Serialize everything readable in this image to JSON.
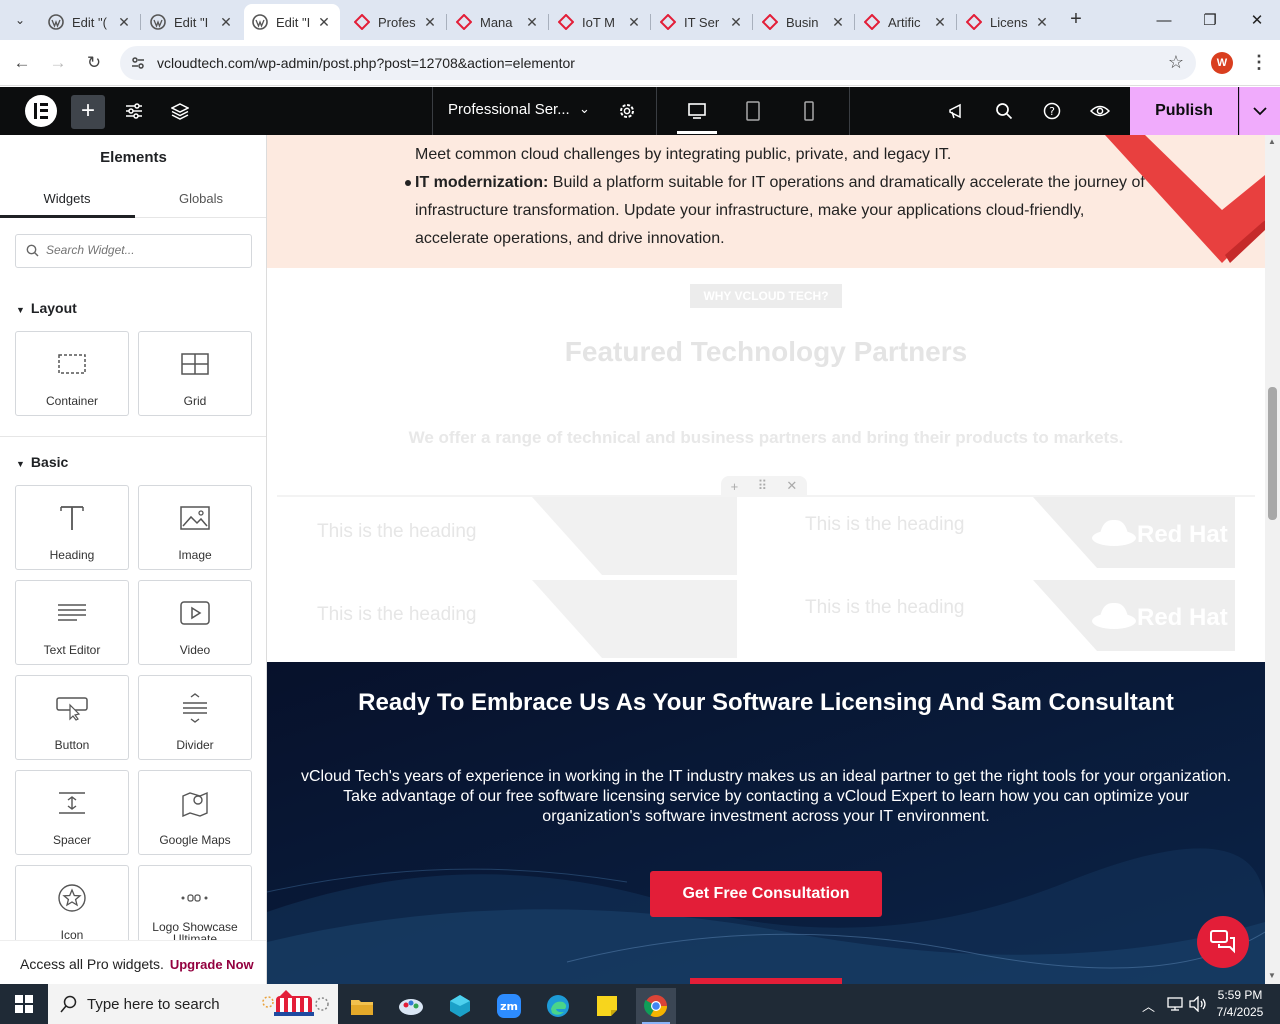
{
  "browser": {
    "tabs": [
      {
        "title": "Edit \"(",
        "icon": "wordpress-icon"
      },
      {
        "title": "Edit \"I",
        "icon": "wordpress-icon"
      },
      {
        "title": "Edit \"I",
        "icon": "wordpress-icon",
        "active": true
      },
      {
        "title": "Profes",
        "icon": "vcloud-icon"
      },
      {
        "title": "Mana",
        "icon": "vcloud-icon"
      },
      {
        "title": "IoT M",
        "icon": "vcloud-icon"
      },
      {
        "title": "IT Ser",
        "icon": "vcloud-icon"
      },
      {
        "title": "Busin",
        "icon": "vcloud-icon"
      },
      {
        "title": "Artific",
        "icon": "vcloud-icon"
      },
      {
        "title": "Licens",
        "icon": "vcloud-icon"
      }
    ],
    "url": "vcloudtech.com/wp-admin/post.php?post=12708&action=elementor",
    "profile_initial": "W"
  },
  "editor": {
    "document_name": "Professional Ser...",
    "publish_label": "Publish"
  },
  "panel": {
    "title": "Elements",
    "tabs": [
      "Widgets",
      "Globals"
    ],
    "search_placeholder": "Search Widget...",
    "categories": {
      "layout": "Layout",
      "basic": "Basic"
    },
    "layout_widgets": [
      {
        "label": "Container",
        "icon": "container-icon"
      },
      {
        "label": "Grid",
        "icon": "grid-icon"
      }
    ],
    "basic_widgets": [
      {
        "label": "Heading",
        "icon": "heading-icon"
      },
      {
        "label": "Image",
        "icon": "image-icon"
      },
      {
        "label": "Text Editor",
        "icon": "text-editor-icon"
      },
      {
        "label": "Video",
        "icon": "video-icon"
      },
      {
        "label": "Button",
        "icon": "button-icon"
      },
      {
        "label": "Divider",
        "icon": "divider-icon"
      },
      {
        "label": "Spacer",
        "icon": "spacer-icon"
      },
      {
        "label": "Google Maps",
        "icon": "google-maps-icon"
      },
      {
        "label": "Icon",
        "icon": "star-icon"
      },
      {
        "label": "Logo Showcase Ultimate",
        "icon": "logo-showcase-icon"
      }
    ],
    "upsell_text": "Access all Pro widgets.",
    "upsell_link": "Upgrade Now"
  },
  "page": {
    "intro_line": "Meet common cloud challenges by integrating public, private, and legacy IT.",
    "bullet_label": "IT modernization:",
    "bullet_text": " Build a platform suitable for IT operations and dramatically accelerate the journey of infrastructure transformation. Update your infrastructure, make your applications cloud-friendly, accelerate operations, and drive innovation.",
    "why_badge": "WHY VCLOUD TECH?",
    "partners_title": "Featured Technology Partners",
    "partners_subtitle": "We offer a range of technical and business partners and bring their products to markets.",
    "partner_cards": [
      {
        "heading": "This is the heading",
        "logo": ""
      },
      {
        "heading": "This is the heading",
        "logo": "Red Hat"
      },
      {
        "heading": "This is the heading",
        "logo": ""
      },
      {
        "heading": "This is the heading",
        "logo": "Red Hat"
      }
    ],
    "cta_title": "Ready To Embrace Us As Your Software Licensing And Sam Consultant",
    "cta_text": "vCloud Tech's years of experience in working in the IT industry makes us an ideal partner to get the right tools for your organization. Take advantage of our free software licensing service by contacting a vCloud Expert to learn how you can optimize your organization's software investment across your IT environment.",
    "cta_button": "Get Free Consultation"
  },
  "taskbar": {
    "search_placeholder": "Type here to search",
    "time": "5:59 PM",
    "date": "7/4/2025"
  },
  "colors": {
    "elementor_black": "#0c0d0e",
    "publish_pink": "#f0abfc",
    "brand_red": "#e31e38",
    "cta_navy": "#07112b",
    "peach": "#fdeae0"
  }
}
